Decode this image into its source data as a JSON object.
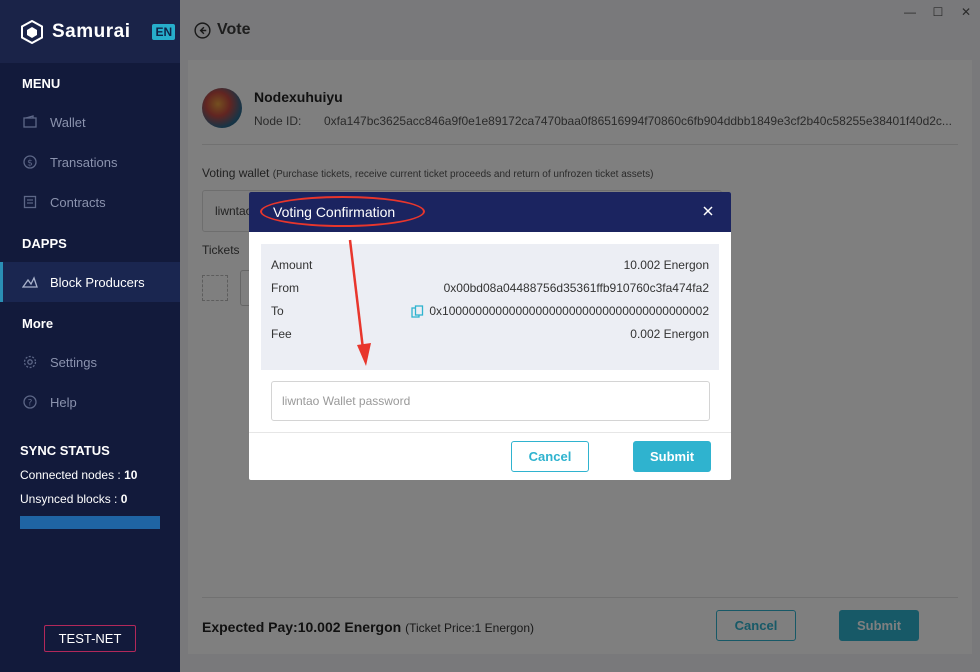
{
  "app": {
    "brand": "Samurai",
    "lang": "EN"
  },
  "sidebar": {
    "menu_title": "MENU",
    "menu_items": [
      {
        "label": "Wallet"
      },
      {
        "label": "Transations"
      },
      {
        "label": "Contracts"
      }
    ],
    "dapps_title": "DAPPS",
    "dapps_items": [
      {
        "label": "Block Producers"
      }
    ],
    "more_title": "More",
    "more_items": [
      {
        "label": "Settings"
      },
      {
        "label": "Help"
      }
    ],
    "sync": {
      "title": "SYNC STATUS",
      "connected_label": "Connected nodes :",
      "connected_value": "10",
      "unsynced_label": "Unsynced blocks :",
      "unsynced_value": "0"
    },
    "network": "TEST-NET"
  },
  "header": {
    "title": "Vote"
  },
  "node": {
    "name": "Nodexuhuiyu",
    "id_label": "Node ID:",
    "id": "0xfa147bc3625acc846a9f0e1e89172ca7470baa0f86516994f70860c6fb904ddbb1849e3cf2b40c58255e38401f40d2c..."
  },
  "form": {
    "voting_wallet_label": "Voting wallet",
    "voting_wallet_hint": "(Purchase tickets, receive current ticket proceeds and return of unfrozen ticket assets)",
    "voting_wallet_value": "liwntao",
    "tickets_label": "Tickets"
  },
  "footer": {
    "expected_label": "Expected Pay:10.002 Energon",
    "ticket_price": "(Ticket Price:1 Energon)",
    "cancel": "Cancel",
    "submit": "Submit"
  },
  "modal": {
    "title": "Voting Confirmation",
    "rows": [
      {
        "label": "Amount",
        "value": "10.002 Energon"
      },
      {
        "label": "From",
        "value": "0x00bd08a04488756d35361ffb910760c3fa474fa2"
      },
      {
        "label": "To",
        "value": "0x1000000000000000000000000000000000000002"
      },
      {
        "label": "Fee",
        "value": "0.002 Energon"
      }
    ],
    "password_placeholder": "liwntao Wallet password",
    "cancel": "Cancel",
    "submit": "Submit"
  },
  "colors": {
    "sidebar_bg": "#121a3b",
    "accent": "#2fb3cf",
    "modal_header": "#1b2460",
    "annotation": "#e8362c"
  }
}
